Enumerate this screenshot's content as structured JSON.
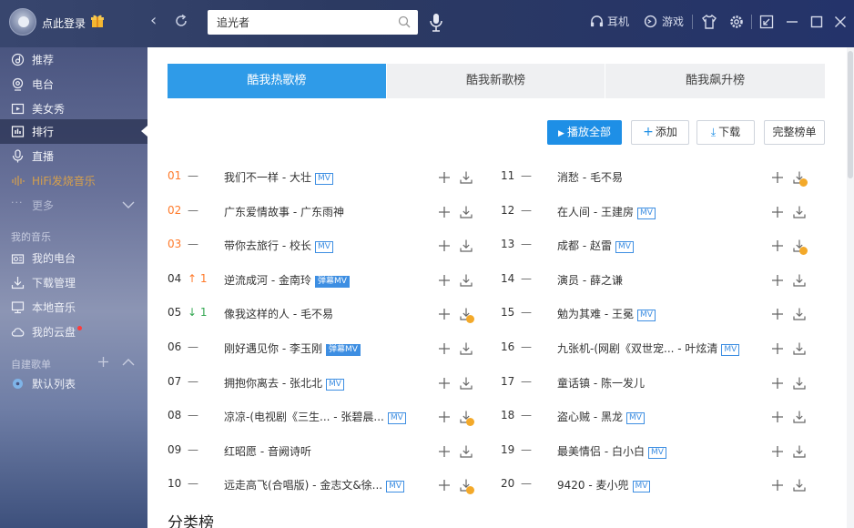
{
  "header": {
    "login": "点此登录",
    "search_value": "追光者",
    "earphone": "耳机",
    "game": "游戏"
  },
  "sidebar": {
    "items": [
      {
        "label": "推荐",
        "icon": "recommend-icon"
      },
      {
        "label": "电台",
        "icon": "radio-icon"
      },
      {
        "label": "美女秀",
        "icon": "video-icon"
      },
      {
        "label": "排行",
        "icon": "rank-icon"
      },
      {
        "label": "直播",
        "icon": "mic-icon"
      },
      {
        "label": "HiFi发烧音乐",
        "icon": "hifi-icon"
      },
      {
        "label": "更多",
        "icon": "more-icon"
      }
    ],
    "my_music_title": "我的音乐",
    "my_music": [
      {
        "label": "我的电台",
        "icon": "my-radio-icon"
      },
      {
        "label": "下载管理",
        "icon": "download-icon"
      },
      {
        "label": "本地音乐",
        "icon": "monitor-icon"
      },
      {
        "label": "我的云盘",
        "icon": "cloud-icon"
      }
    ],
    "playlist_title": "自建歌单",
    "playlists": [
      {
        "label": "默认列表",
        "icon": "list-icon"
      }
    ]
  },
  "tabs": [
    "酷我热歌榜",
    "酷我新歌榜",
    "酷我飙升榜"
  ],
  "actions": {
    "play_all": "播放全部",
    "add": "添加",
    "download": "下载",
    "full_list": "完整榜单"
  },
  "songs_left": [
    {
      "rank": "01",
      "trend": "—",
      "title": "我们不一样 - 大壮",
      "tag": "MV"
    },
    {
      "rank": "02",
      "trend": "—",
      "title": "广东爱情故事 - 广东雨神",
      "tag": ""
    },
    {
      "rank": "03",
      "trend": "—",
      "title": "带你去旅行 - 校长",
      "tag": "MV"
    },
    {
      "rank": "04",
      "trend": "↑ 1",
      "title": "逆流成河 - 金南玲",
      "tag": "弹幕MV"
    },
    {
      "rank": "05",
      "trend": "↓ 1",
      "title": "像我这样的人 - 毛不易",
      "tag": ""
    },
    {
      "rank": "06",
      "trend": "—",
      "title": "刚好遇见你 - 李玉刚",
      "tag": "弹幕MV"
    },
    {
      "rank": "07",
      "trend": "—",
      "title": "拥抱你离去 - 张北北",
      "tag": "MV"
    },
    {
      "rank": "08",
      "trend": "—",
      "title": "凉凉-(电视剧《三生... - 张碧晨...",
      "tag": "MV"
    },
    {
      "rank": "09",
      "trend": "—",
      "title": "红昭愿 - 音阙诗听",
      "tag": ""
    },
    {
      "rank": "10",
      "trend": "—",
      "title": "远走高飞(合唱版) - 金志文&徐...",
      "tag": "MV"
    }
  ],
  "songs_right": [
    {
      "rank": "11",
      "trend": "—",
      "title": "消愁 - 毛不易",
      "tag": ""
    },
    {
      "rank": "12",
      "trend": "—",
      "title": "在人间 - 王建房",
      "tag": "MV"
    },
    {
      "rank": "13",
      "trend": "—",
      "title": "成都 - 赵雷",
      "tag": "MV"
    },
    {
      "rank": "14",
      "trend": "—",
      "title": "演员 - 薛之谦",
      "tag": ""
    },
    {
      "rank": "15",
      "trend": "—",
      "title": "勉为其难 - 王冕",
      "tag": "MV"
    },
    {
      "rank": "16",
      "trend": "—",
      "title": "九张机-(网剧《双世宠... - 叶炫清",
      "tag": "MV"
    },
    {
      "rank": "17",
      "trend": "—",
      "title": "童话镇 - 陈一发儿",
      "tag": ""
    },
    {
      "rank": "18",
      "trend": "—",
      "title": "盗心贼 - 黑龙",
      "tag": "MV"
    },
    {
      "rank": "19",
      "trend": "—",
      "title": "最美情侣 - 白小白",
      "tag": "MV"
    },
    {
      "rank": "20",
      "trend": "—",
      "title": "9420 - 麦小兜",
      "tag": "MV"
    }
  ],
  "category_title": "分类榜",
  "colors": {
    "accent": "#2f9be8",
    "top_rank": "#ff7a2a",
    "down": "#35a853",
    "coin": "#f3a92a"
  }
}
